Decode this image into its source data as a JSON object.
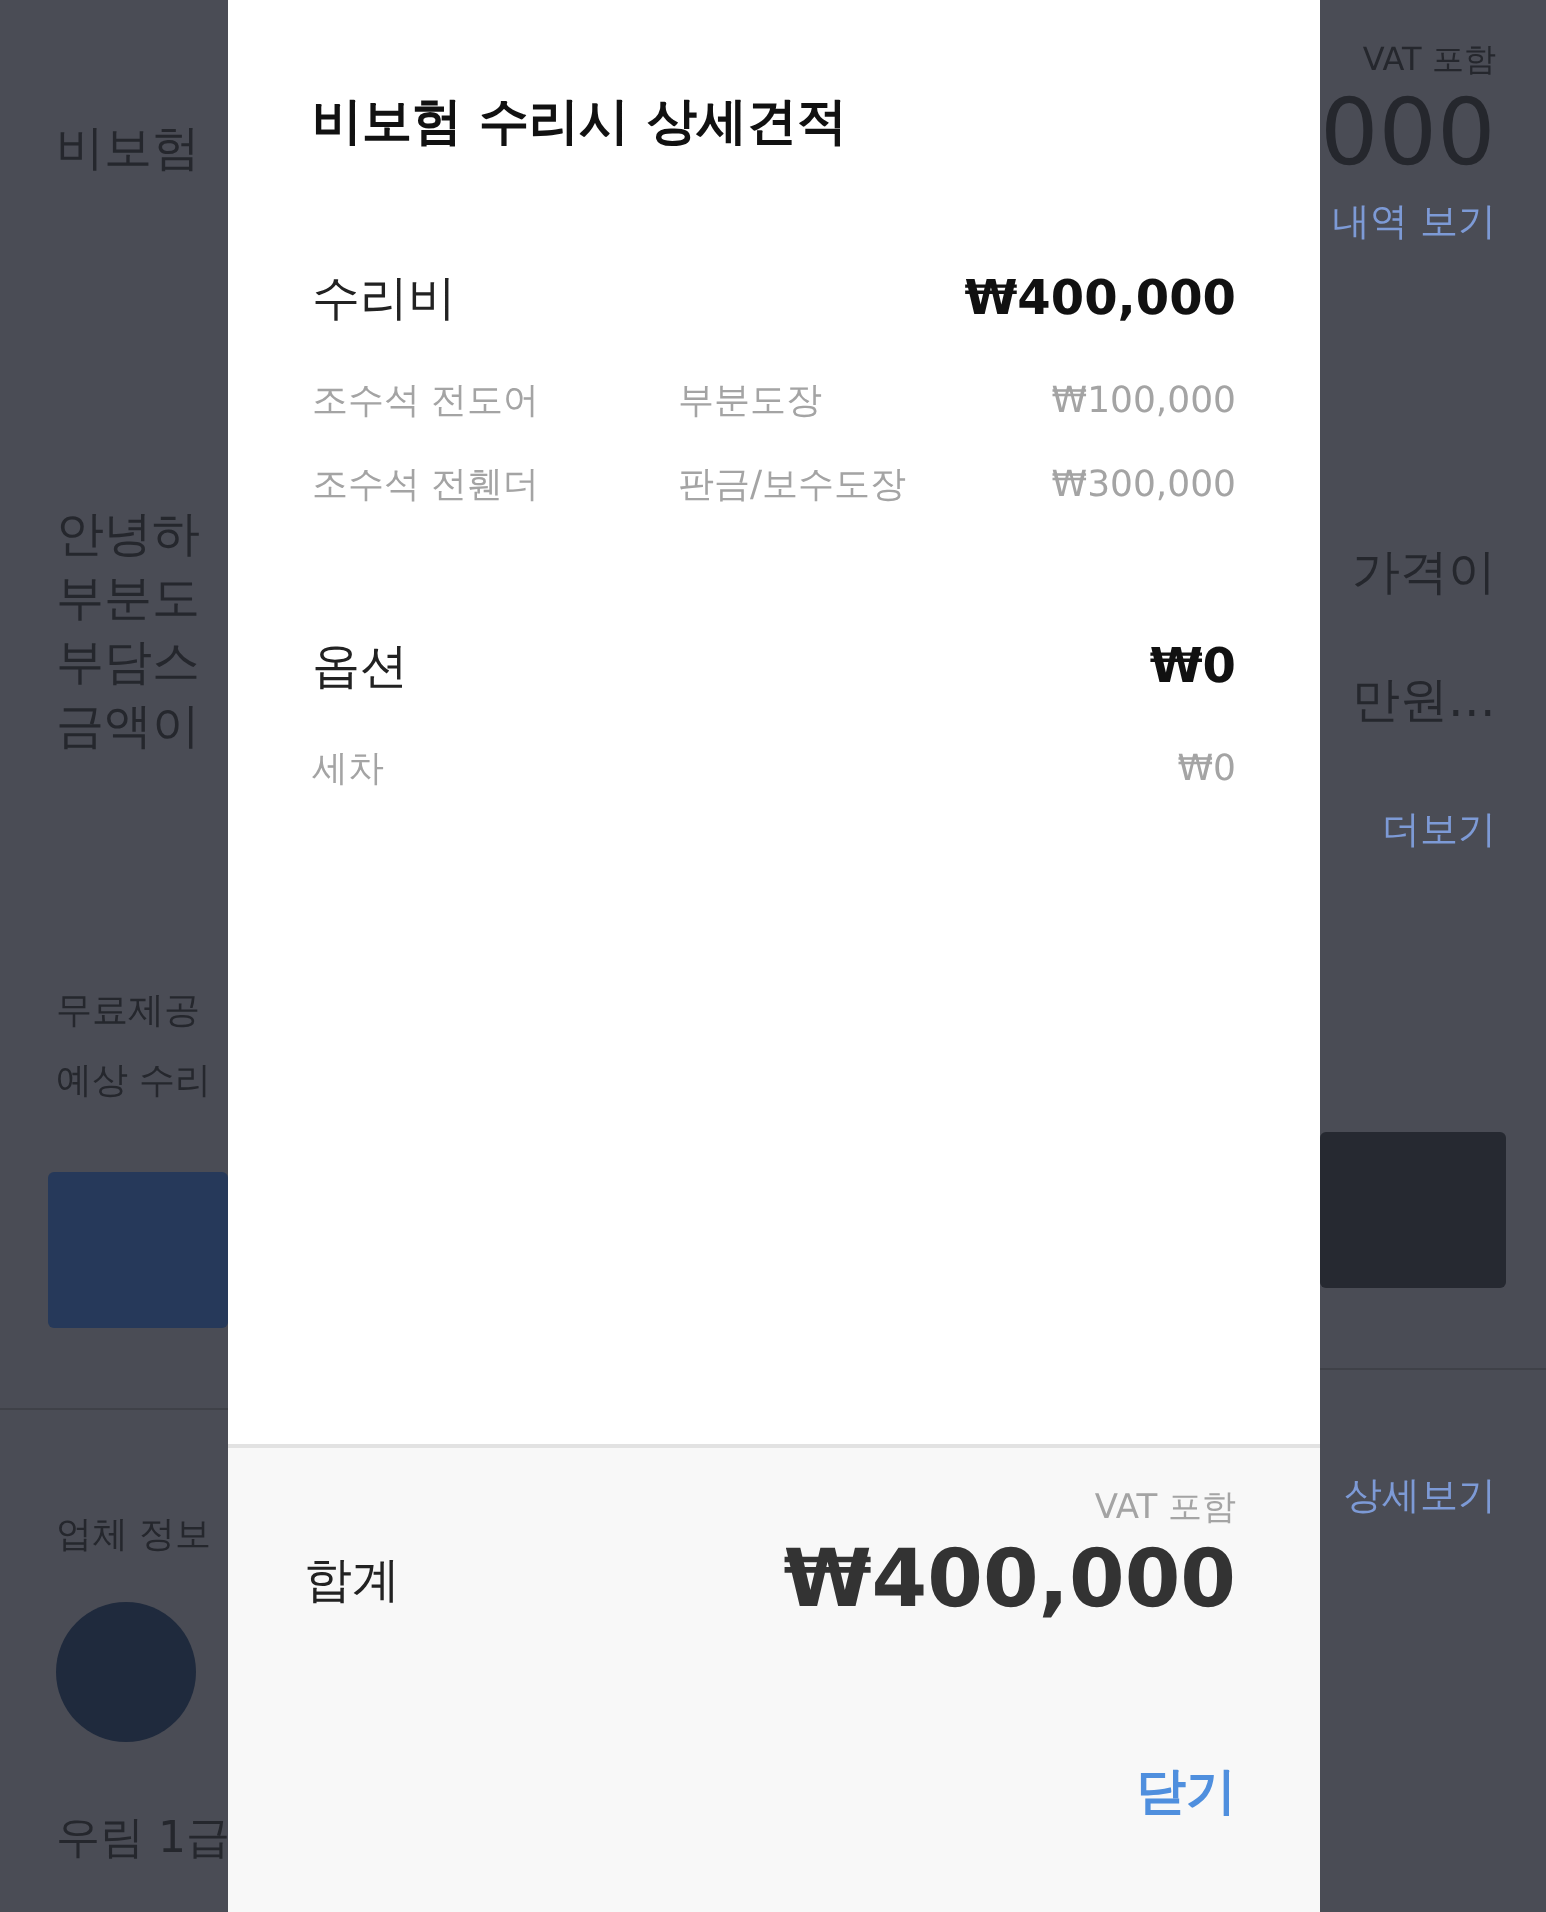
{
  "background": {
    "title_fragment": "비보험",
    "intro_left": [
      "안녕하",
      "부분도",
      "부담스",
      "금액이"
    ],
    "free_label": "무료제공",
    "estimate_label": "예상 수리",
    "company_label": "업체 정보",
    "company_name": "우림 1급",
    "vat_note": "VAT 포함",
    "price_fragment": "000",
    "history_link": "내역 보기",
    "intro_right": [
      "가격이",
      "만원…"
    ],
    "more_link": "더보기",
    "company_detail_link": "상세보기"
  },
  "dialog": {
    "title": "비보험 수리시 상세견적",
    "sections": [
      {
        "label": "수리비",
        "total": "₩400,000",
        "items": [
          {
            "part": "조수석 전도어",
            "work": "부분도장",
            "price": "₩100,000"
          },
          {
            "part": "조수석 전휀더",
            "work": "판금/보수도장",
            "price": "₩300,000"
          }
        ]
      },
      {
        "label": "옵션",
        "total": "₩0",
        "items": [
          {
            "part": "세차",
            "price": "₩0"
          }
        ]
      }
    ],
    "footer": {
      "vat_note": "VAT 포함",
      "total_label": "합계",
      "total_amount": "₩400,000",
      "close_button": "닫기"
    }
  }
}
